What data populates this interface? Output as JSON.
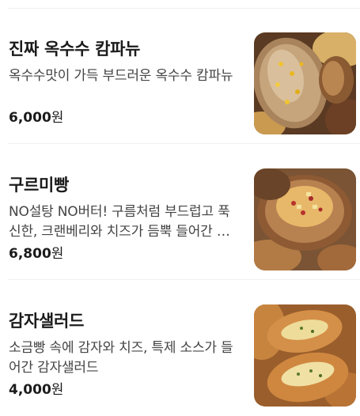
{
  "menu": {
    "items": [
      {
        "name": "진짜 옥수수 캄파뉴",
        "description": "옥수수맛이 가득 부드러운 옥수수 캄파뉴",
        "price": "6,000",
        "currency": "원",
        "image_alt": "corn-campagne-bread-photo"
      },
      {
        "name": "구르미빵",
        "description": "NO설탕 NO버터! 구름처럼 부드럽고 푹신한, 크랜베리와 치즈가 듬뿍 들어간 구르미빵",
        "price": "6,800",
        "currency": "원",
        "image_alt": "gurumi-bread-photo"
      },
      {
        "name": "감자샐러드",
        "description": "소금빵 속에 감자와 치즈, 특제 소스가 들어간 감자샐러드",
        "price": "4,000",
        "currency": "원",
        "image_alt": "potato-salad-bread-photo"
      }
    ]
  }
}
